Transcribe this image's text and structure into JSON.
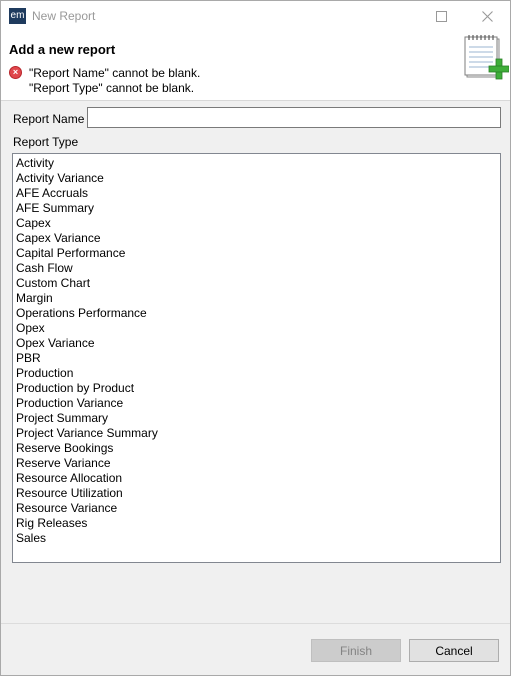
{
  "window": {
    "app_icon_text": "em",
    "title": "New Report"
  },
  "header": {
    "title": "Add a new report",
    "errors": [
      "\"Report Name\" cannot be blank.",
      "\"Report Type\" cannot be blank."
    ],
    "error_icon": "error-circle-x-icon",
    "banner_icon": "notepad-add-icon"
  },
  "form": {
    "report_name_label": "Report Name",
    "report_name_value": "",
    "report_type_label": "Report Type",
    "report_types": [
      "Activity",
      "Activity Variance",
      "AFE Accruals",
      "AFE Summary",
      "Capex",
      "Capex Variance",
      "Capital Performance",
      "Cash Flow",
      "Custom Chart",
      "Margin",
      "Operations Performance",
      "Opex",
      "Opex Variance",
      "PBR",
      "Production",
      "Production by Product",
      "Production Variance",
      "Project Summary",
      "Project Variance Summary",
      "Reserve Bookings",
      "Reserve Variance",
      "Resource Allocation",
      "Resource Utilization",
      "Resource Variance",
      "Rig Releases",
      "Sales"
    ]
  },
  "buttons": {
    "finish": "Finish",
    "cancel": "Cancel"
  },
  "colors": {
    "error": "#e0464b",
    "window_bg": "#f0f0f0"
  }
}
